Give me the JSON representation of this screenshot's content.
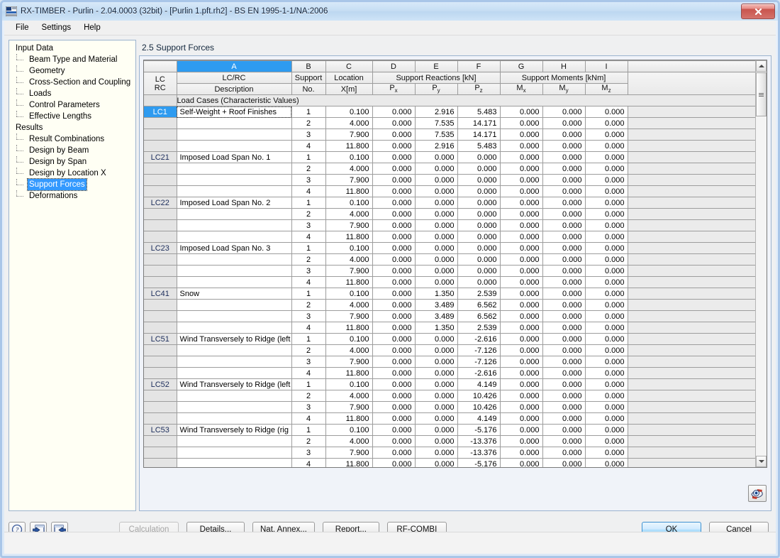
{
  "window": {
    "title": "RX-TIMBER - Purlin - 2.04.0003 (32bit) - [Purlin 1.pft.rh2] - BS EN 1995-1-1/NA:2006",
    "close_label": "✕",
    "app_icon": "rx-timber-icon"
  },
  "menu": {
    "items": [
      "File",
      "Settings",
      "Help"
    ]
  },
  "tree": {
    "nodes": [
      {
        "label": "Input Data",
        "level": 0,
        "selected": false
      },
      {
        "label": "Beam Type and Material",
        "level": 1,
        "selected": false
      },
      {
        "label": "Geometry",
        "level": 1,
        "selected": false
      },
      {
        "label": "Cross-Section and Coupling",
        "level": 1,
        "selected": false
      },
      {
        "label": "Loads",
        "level": 1,
        "selected": false
      },
      {
        "label": "Control Parameters",
        "level": 1,
        "selected": false
      },
      {
        "label": "Effective Lengths",
        "level": 1,
        "selected": false,
        "last": true
      },
      {
        "label": "Results",
        "level": 0,
        "selected": false
      },
      {
        "label": "Result Combinations",
        "level": 1,
        "selected": false
      },
      {
        "label": "Design by Beam",
        "level": 1,
        "selected": false
      },
      {
        "label": "Design by Span",
        "level": 1,
        "selected": false
      },
      {
        "label": "Design by Location X",
        "level": 1,
        "selected": false
      },
      {
        "label": "Support Forces",
        "level": 1,
        "selected": true
      },
      {
        "label": "Deformations",
        "level": 1,
        "selected": false,
        "last": true
      }
    ]
  },
  "panel": {
    "title": "2.5 Support Forces"
  },
  "grid": {
    "column_letters": [
      "A",
      "B",
      "C",
      "D",
      "E",
      "F",
      "G",
      "H",
      "I"
    ],
    "selected_column": "A",
    "row_header": {
      "line1": "LC",
      "line2": "RC"
    },
    "headers_top": {
      "a": "LC/RC",
      "b": "Support",
      "c": "Location",
      "reactions": "Support Reactions [kN]",
      "moments": "Support Moments [kNm]"
    },
    "headers_bottom": {
      "a": "Description",
      "b": "No.",
      "c": "X[m]",
      "d": "Px",
      "e": "Py",
      "f": "Pz",
      "g": "Mx",
      "h": "My",
      "i": "Mz"
    },
    "section_title": "Load Cases (Characteristic Values)",
    "selected_cell": "LC1",
    "rows": [
      {
        "lc": "LC1",
        "desc": "Self-Weight + Roof Finishes",
        "no": "1",
        "x": "0.100",
        "px": "0.000",
        "py": "2.916",
        "pz": "5.483",
        "mx": "0.000",
        "my": "0.000",
        "mz": "0.000"
      },
      {
        "lc": "",
        "desc": "",
        "no": "2",
        "x": "4.000",
        "px": "0.000",
        "py": "7.535",
        "pz": "14.171",
        "mx": "0.000",
        "my": "0.000",
        "mz": "0.000"
      },
      {
        "lc": "",
        "desc": "",
        "no": "3",
        "x": "7.900",
        "px": "0.000",
        "py": "7.535",
        "pz": "14.171",
        "mx": "0.000",
        "my": "0.000",
        "mz": "0.000"
      },
      {
        "lc": "",
        "desc": "",
        "no": "4",
        "x": "11.800",
        "px": "0.000",
        "py": "2.916",
        "pz": "5.483",
        "mx": "0.000",
        "my": "0.000",
        "mz": "0.000"
      },
      {
        "lc": "LC21",
        "desc": "Imposed Load Span No. 1",
        "no": "1",
        "x": "0.100",
        "px": "0.000",
        "py": "0.000",
        "pz": "0.000",
        "mx": "0.000",
        "my": "0.000",
        "mz": "0.000"
      },
      {
        "lc": "",
        "desc": "",
        "no": "2",
        "x": "4.000",
        "px": "0.000",
        "py": "0.000",
        "pz": "0.000",
        "mx": "0.000",
        "my": "0.000",
        "mz": "0.000"
      },
      {
        "lc": "",
        "desc": "",
        "no": "3",
        "x": "7.900",
        "px": "0.000",
        "py": "0.000",
        "pz": "0.000",
        "mx": "0.000",
        "my": "0.000",
        "mz": "0.000"
      },
      {
        "lc": "",
        "desc": "",
        "no": "4",
        "x": "11.800",
        "px": "0.000",
        "py": "0.000",
        "pz": "0.000",
        "mx": "0.000",
        "my": "0.000",
        "mz": "0.000"
      },
      {
        "lc": "LC22",
        "desc": "Imposed Load Span No. 2",
        "no": "1",
        "x": "0.100",
        "px": "0.000",
        "py": "0.000",
        "pz": "0.000",
        "mx": "0.000",
        "my": "0.000",
        "mz": "0.000"
      },
      {
        "lc": "",
        "desc": "",
        "no": "2",
        "x": "4.000",
        "px": "0.000",
        "py": "0.000",
        "pz": "0.000",
        "mx": "0.000",
        "my": "0.000",
        "mz": "0.000"
      },
      {
        "lc": "",
        "desc": "",
        "no": "3",
        "x": "7.900",
        "px": "0.000",
        "py": "0.000",
        "pz": "0.000",
        "mx": "0.000",
        "my": "0.000",
        "mz": "0.000"
      },
      {
        "lc": "",
        "desc": "",
        "no": "4",
        "x": "11.800",
        "px": "0.000",
        "py": "0.000",
        "pz": "0.000",
        "mx": "0.000",
        "my": "0.000",
        "mz": "0.000"
      },
      {
        "lc": "LC23",
        "desc": "Imposed Load Span No. 3",
        "no": "1",
        "x": "0.100",
        "px": "0.000",
        "py": "0.000",
        "pz": "0.000",
        "mx": "0.000",
        "my": "0.000",
        "mz": "0.000"
      },
      {
        "lc": "",
        "desc": "",
        "no": "2",
        "x": "4.000",
        "px": "0.000",
        "py": "0.000",
        "pz": "0.000",
        "mx": "0.000",
        "my": "0.000",
        "mz": "0.000"
      },
      {
        "lc": "",
        "desc": "",
        "no": "3",
        "x": "7.900",
        "px": "0.000",
        "py": "0.000",
        "pz": "0.000",
        "mx": "0.000",
        "my": "0.000",
        "mz": "0.000"
      },
      {
        "lc": "",
        "desc": "",
        "no": "4",
        "x": "11.800",
        "px": "0.000",
        "py": "0.000",
        "pz": "0.000",
        "mx": "0.000",
        "my": "0.000",
        "mz": "0.000"
      },
      {
        "lc": "LC41",
        "desc": "Snow",
        "no": "1",
        "x": "0.100",
        "px": "0.000",
        "py": "1.350",
        "pz": "2.539",
        "mx": "0.000",
        "my": "0.000",
        "mz": "0.000"
      },
      {
        "lc": "",
        "desc": "",
        "no": "2",
        "x": "4.000",
        "px": "0.000",
        "py": "3.489",
        "pz": "6.562",
        "mx": "0.000",
        "my": "0.000",
        "mz": "0.000"
      },
      {
        "lc": "",
        "desc": "",
        "no": "3",
        "x": "7.900",
        "px": "0.000",
        "py": "3.489",
        "pz": "6.562",
        "mx": "0.000",
        "my": "0.000",
        "mz": "0.000"
      },
      {
        "lc": "",
        "desc": "",
        "no": "4",
        "x": "11.800",
        "px": "0.000",
        "py": "1.350",
        "pz": "2.539",
        "mx": "0.000",
        "my": "0.000",
        "mz": "0.000"
      },
      {
        "lc": "LC51",
        "desc": "Wind Transversely to Ridge (left",
        "no": "1",
        "x": "0.100",
        "px": "0.000",
        "py": "0.000",
        "pz": "-2.616",
        "mx": "0.000",
        "my": "0.000",
        "mz": "0.000"
      },
      {
        "lc": "",
        "desc": "",
        "no": "2",
        "x": "4.000",
        "px": "0.000",
        "py": "0.000",
        "pz": "-7.126",
        "mx": "0.000",
        "my": "0.000",
        "mz": "0.000"
      },
      {
        "lc": "",
        "desc": "",
        "no": "3",
        "x": "7.900",
        "px": "0.000",
        "py": "0.000",
        "pz": "-7.126",
        "mx": "0.000",
        "my": "0.000",
        "mz": "0.000"
      },
      {
        "lc": "",
        "desc": "",
        "no": "4",
        "x": "11.800",
        "px": "0.000",
        "py": "0.000",
        "pz": "-2.616",
        "mx": "0.000",
        "my": "0.000",
        "mz": "0.000"
      },
      {
        "lc": "LC52",
        "desc": "Wind Transversely to Ridge (left",
        "no": "1",
        "x": "0.100",
        "px": "0.000",
        "py": "0.000",
        "pz": "4.149",
        "mx": "0.000",
        "my": "0.000",
        "mz": "0.000"
      },
      {
        "lc": "",
        "desc": "",
        "no": "2",
        "x": "4.000",
        "px": "0.000",
        "py": "0.000",
        "pz": "10.426",
        "mx": "0.000",
        "my": "0.000",
        "mz": "0.000"
      },
      {
        "lc": "",
        "desc": "",
        "no": "3",
        "x": "7.900",
        "px": "0.000",
        "py": "0.000",
        "pz": "10.426",
        "mx": "0.000",
        "my": "0.000",
        "mz": "0.000"
      },
      {
        "lc": "",
        "desc": "",
        "no": "4",
        "x": "11.800",
        "px": "0.000",
        "py": "0.000",
        "pz": "4.149",
        "mx": "0.000",
        "my": "0.000",
        "mz": "0.000"
      },
      {
        "lc": "LC53",
        "desc": "Wind Transversely to Ridge (rig",
        "no": "1",
        "x": "0.100",
        "px": "0.000",
        "py": "0.000",
        "pz": "-5.176",
        "mx": "0.000",
        "my": "0.000",
        "mz": "0.000"
      },
      {
        "lc": "",
        "desc": "",
        "no": "2",
        "x": "4.000",
        "px": "0.000",
        "py": "0.000",
        "pz": "-13.376",
        "mx": "0.000",
        "my": "0.000",
        "mz": "0.000"
      },
      {
        "lc": "",
        "desc": "",
        "no": "3",
        "x": "7.900",
        "px": "0.000",
        "py": "0.000",
        "pz": "-13.376",
        "mx": "0.000",
        "my": "0.000",
        "mz": "0.000"
      },
      {
        "lc": "",
        "desc": "",
        "no": "4",
        "x": "11.800",
        "px": "0.000",
        "py": "0.000",
        "pz": "-5.176",
        "mx": "0.000",
        "my": "0.000",
        "mz": "0.000"
      }
    ]
  },
  "toolbar": {
    "help_icon": "question-mark-icon",
    "prev_icon": "previous-arrow-icon",
    "next_icon": "next-arrow-icon",
    "visibility_icon": "eye-visibility-icon"
  },
  "buttons": {
    "calculation": "Calculation",
    "details": "Details...",
    "nat_annex": "Nat. Annex...",
    "report": "Report...",
    "rf_combi": "RF-COMBI",
    "ok": "OK",
    "cancel": "Cancel"
  },
  "colors": {
    "accent": "#2e9bf0",
    "title_bar": "#c5ddf3",
    "close_button": "#c8544d",
    "grid_header": "#e9e9e9"
  }
}
